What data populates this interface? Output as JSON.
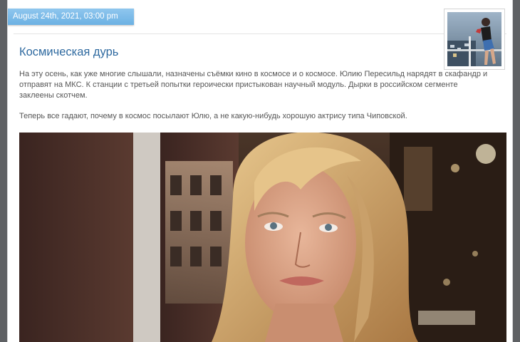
{
  "post": {
    "date": "August 24th, 2021, 03:00 pm",
    "title": "Космическая дурь",
    "paragraph1": "На эту осень, как уже многие слышали, назначены съёмки кино в космосе и о космосе. Юлию Пересильд нарядят в скафандр и отправят на МКС. К станции с третьей попытки героически пристыкован научный модуль. Дырки в российском сегменте заклеены скотчем.",
    "paragraph2": "Теперь все гадают, почему в космос посылают Юлю, а не какую-нибудь хорошую актрису типа Чиповской."
  },
  "colors": {
    "ribbon": "#7bbbe8",
    "title": "#2f6aa0",
    "text": "#555555"
  }
}
